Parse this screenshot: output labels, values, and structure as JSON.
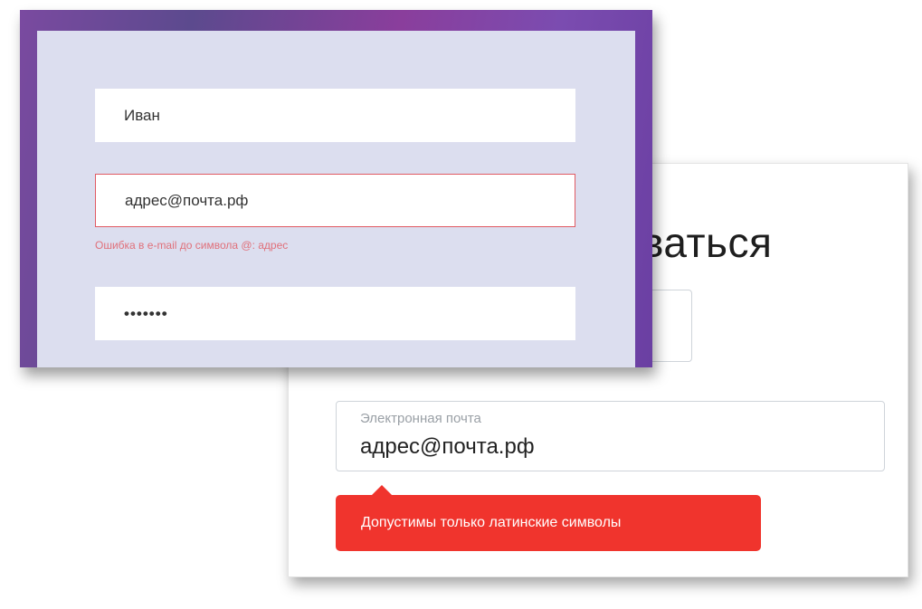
{
  "back_form": {
    "heading_partial": "ваться",
    "email_label": "Электронная почта",
    "email_value": "адрес@почта.рф",
    "error_tooltip": "Допустимы только латинские символы"
  },
  "front_form": {
    "first_name_value": "Иван",
    "email_value": "адрес@почта.рф",
    "email_error": "Ошибка в e-mail до символа @: адрес",
    "password_value": "•••••••"
  },
  "colors": {
    "error_red": "#f0342d",
    "error_border": "#e05a63",
    "error_text": "#e0707a",
    "frame_purple": "#7b4cb0",
    "form_background": "#dcdeef"
  }
}
